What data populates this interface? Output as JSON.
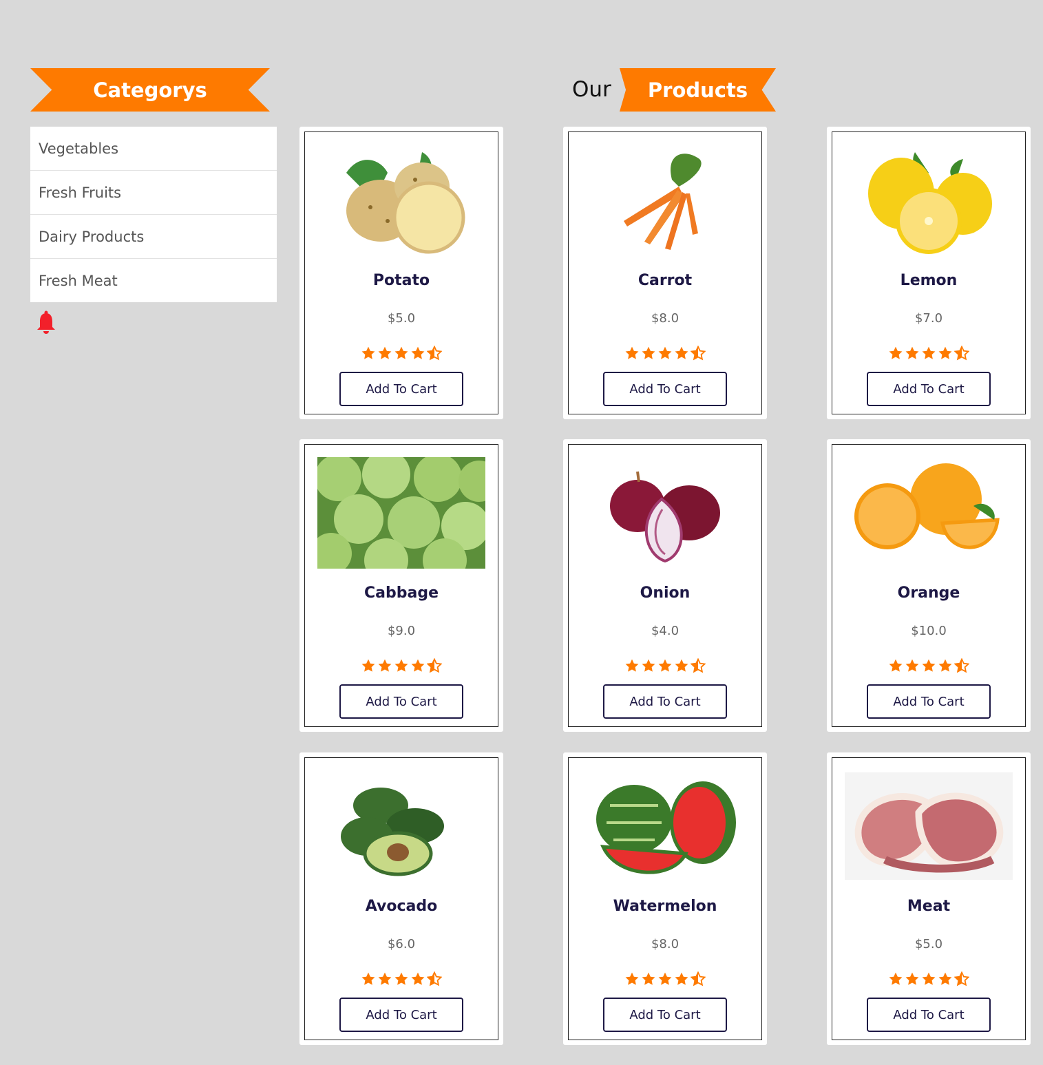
{
  "sidebar": {
    "title": "Categorys",
    "categories": [
      {
        "label": "Vegetables"
      },
      {
        "label": "Fresh Fruits"
      },
      {
        "label": "Dairy Products"
      },
      {
        "label": "Fresh Meat"
      }
    ],
    "bell_icon": "bell-icon",
    "bell_color": "#f2202a"
  },
  "header": {
    "prefix": "Our",
    "title": "Products",
    "accent_color": "#fe7a00"
  },
  "products": [
    {
      "name": "Potato",
      "price": "$5.0",
      "rating": 4.5,
      "button": "Add To Cart",
      "image": "potato"
    },
    {
      "name": "Carrot",
      "price": "$8.0",
      "rating": 4.5,
      "button": "Add To Cart",
      "image": "carrot"
    },
    {
      "name": "Lemon",
      "price": "$7.0",
      "rating": 4.5,
      "button": "Add To Cart",
      "image": "lemon"
    },
    {
      "name": "Cabbage",
      "price": "$9.0",
      "rating": 4.5,
      "button": "Add To Cart",
      "image": "cabbage"
    },
    {
      "name": "Onion",
      "price": "$4.0",
      "rating": 4.5,
      "button": "Add To Cart",
      "image": "onion"
    },
    {
      "name": "Orange",
      "price": "$10.0",
      "rating": 4.5,
      "button": "Add To Cart",
      "image": "orange"
    },
    {
      "name": "Avocado",
      "price": "$6.0",
      "rating": 4.5,
      "button": "Add To Cart",
      "image": "avocado"
    },
    {
      "name": "Watermelon",
      "price": "$8.0",
      "rating": 4.5,
      "button": "Add To Cart",
      "image": "watermelon"
    },
    {
      "name": "Meat",
      "price": "$5.0",
      "rating": 4.5,
      "button": "Add To Cart",
      "image": "meat"
    }
  ]
}
